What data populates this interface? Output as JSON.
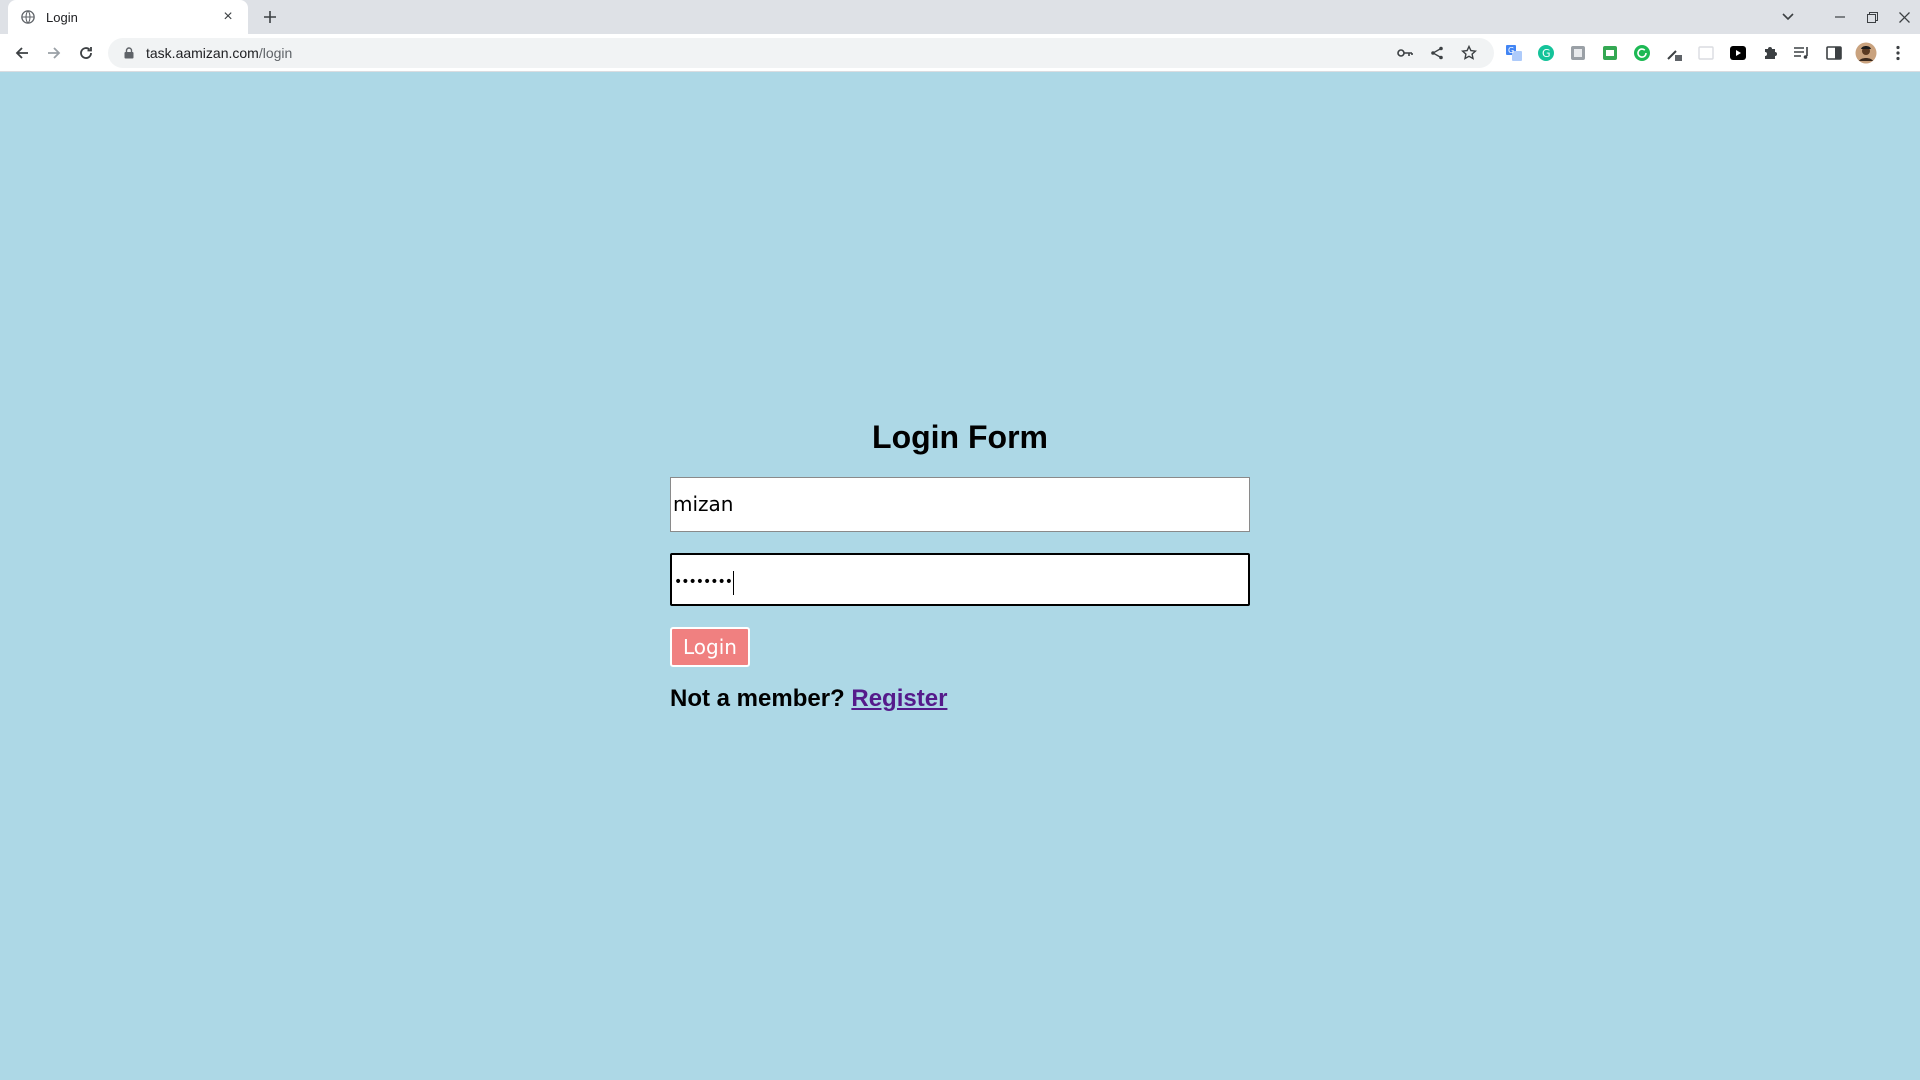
{
  "browser": {
    "tab": {
      "title": "Login",
      "favicon": "globe-icon",
      "close": "×"
    },
    "new_tab": "+",
    "url_host": "task.aamizan.com",
    "url_path": "/login",
    "window_controls": [
      "chevron-down-icon",
      "minimize-icon",
      "restore-icon",
      "close-icon"
    ],
    "omnibox_icons": [
      "key-icon",
      "share-icon",
      "star-icon"
    ],
    "extensions": [
      "translate-icon",
      "grammarly-icon",
      "extension-gray-icon",
      "extension-green-icon",
      "extension-refresh-icon",
      "eyedropper-icon",
      "extension-blank-icon",
      "play-icon",
      "puzzle-icon",
      "reading-list-icon",
      "side-panel-icon",
      "avatar",
      "more-icon"
    ]
  },
  "colors": {
    "page_bg": "#add8e6",
    "button_bg": "#f08080",
    "link": "#551a8b"
  },
  "form": {
    "title": "Login Form",
    "username_value": "mizan",
    "password_value": "••••••••",
    "login_label": "Login",
    "member_text": "Not a member?",
    "register_label": "Register"
  }
}
